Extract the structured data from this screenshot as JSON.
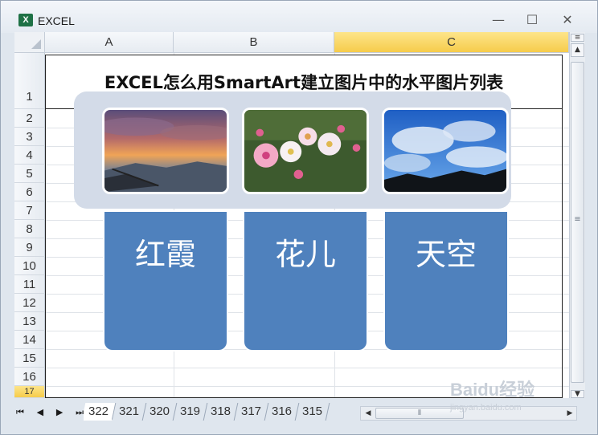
{
  "window": {
    "title": "EXCEL",
    "app_icon_letter": "X",
    "minimize_glyph": "—",
    "restore_glyph": "☐",
    "close_glyph": "✕"
  },
  "columns": [
    {
      "label": "A",
      "selected": false
    },
    {
      "label": "B",
      "selected": false
    },
    {
      "label": "C",
      "selected": true
    }
  ],
  "rows": [
    "1",
    "2",
    "3",
    "4",
    "5",
    "6",
    "7",
    "8",
    "9",
    "10",
    "11",
    "12",
    "13",
    "14",
    "15",
    "16",
    "17"
  ],
  "title_cell": "EXCEL怎么用SmartArt建立图片中的水平图片列表",
  "smartart": {
    "items": [
      {
        "label": "红霞",
        "image": "sunset-clouds-photo"
      },
      {
        "label": "花儿",
        "image": "pink-flowers-photo"
      },
      {
        "label": "天空",
        "image": "blue-sky-photo"
      }
    ],
    "band_color": "#d3dbe8",
    "box_color": "#4f81bd"
  },
  "sheet_nav": {
    "first": "⏮",
    "prev": "◀",
    "next": "▶",
    "last": "⏭"
  },
  "sheet_tabs": [
    "322",
    "321",
    "320",
    "319",
    "318",
    "317",
    "316",
    "315"
  ],
  "active_sheet": "322",
  "scroll": {
    "grip": "≡",
    "hgrip": "⦀",
    "up": "▲",
    "down": "▼",
    "left": "◀",
    "right": "▶"
  },
  "watermark": {
    "brand": "Baidu经验",
    "site": "jingyan.baidu.com"
  }
}
